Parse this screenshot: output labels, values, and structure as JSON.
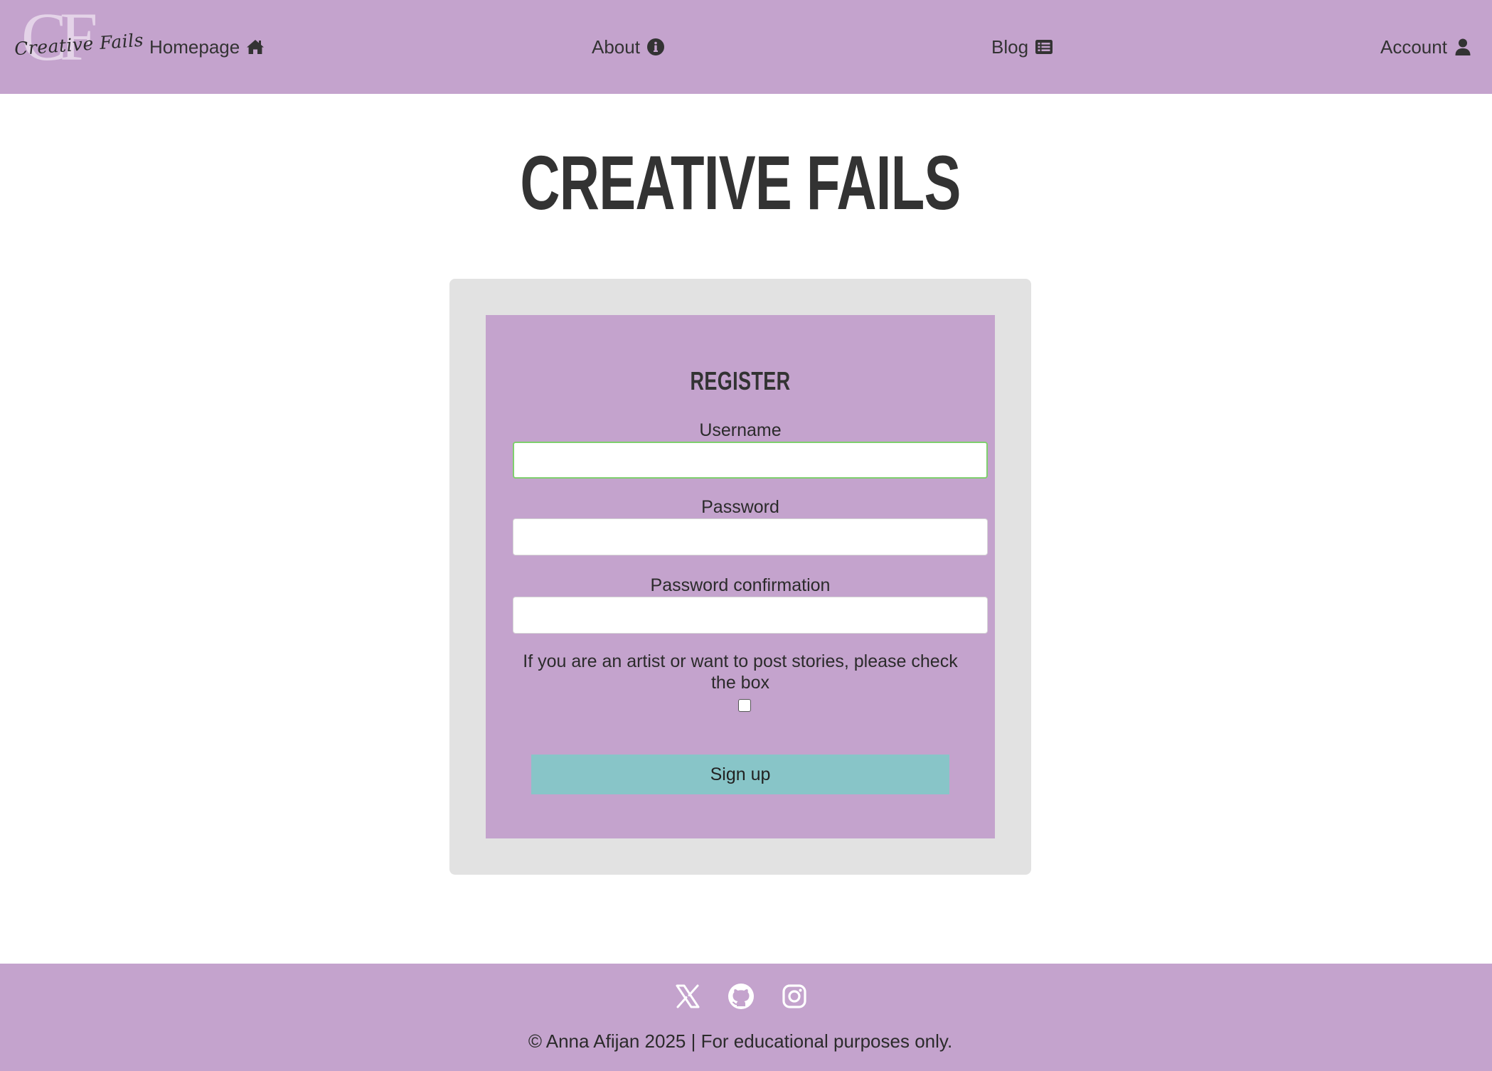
{
  "header": {
    "logo": {
      "monogram": "CF",
      "script": "Creative Fails"
    },
    "nav": {
      "home": {
        "label": "Homepage",
        "icon": "home-icon"
      },
      "about": {
        "label": "About",
        "icon": "info-circle-icon"
      },
      "blog": {
        "label": "Blog",
        "icon": "list-alt-icon"
      },
      "account": {
        "label": "Account",
        "icon": "user-icon"
      }
    }
  },
  "main": {
    "title": "CREATIVE FAILS",
    "form": {
      "heading": "REGISTER",
      "username": {
        "label": "Username",
        "value": ""
      },
      "password": {
        "label": "Password",
        "value": ""
      },
      "password_confirmation": {
        "label": "Password confirmation",
        "value": ""
      },
      "artist_prompt": "If you are an artist or want to post stories, please check the box",
      "artist_checked": false,
      "submit_label": "Sign up"
    }
  },
  "footer": {
    "social": [
      "x-icon",
      "github-icon",
      "instagram-icon"
    ],
    "copyright": "© Anna Afijan 2025 | For educational purposes only."
  },
  "colors": {
    "header_bg": "#c4a3cd",
    "card_bg": "#e2e2e2",
    "button_bg": "#88c5c8",
    "focus_border": "#7fcf6e",
    "text": "#333333"
  }
}
